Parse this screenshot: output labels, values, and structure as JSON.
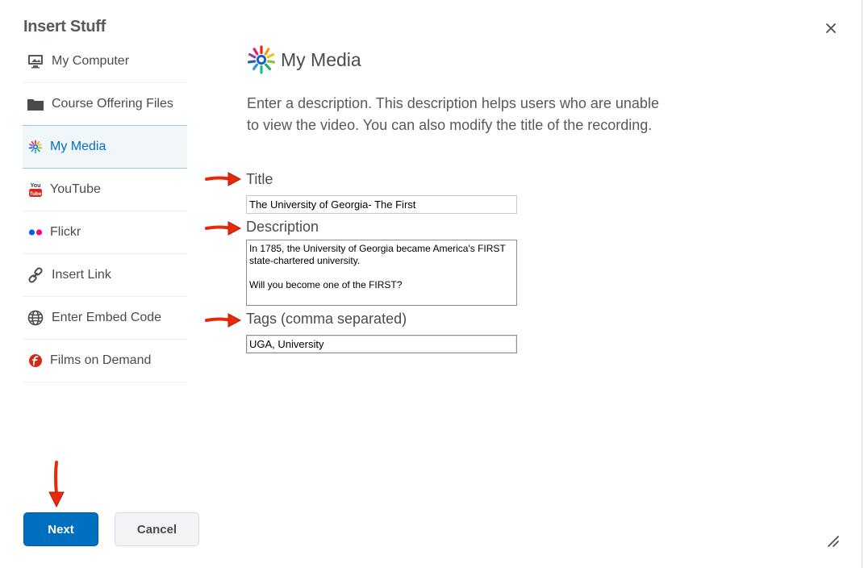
{
  "dialog": {
    "title": "Insert Stuff"
  },
  "sidebar": {
    "items": [
      {
        "label": "My Computer",
        "icon": "monitor-icon"
      },
      {
        "label": "Course Offering Files",
        "icon": "folder-icon"
      },
      {
        "label": "My Media",
        "icon": "my-media-logo-icon",
        "selected": true
      },
      {
        "label": "YouTube",
        "icon": "youtube-icon"
      },
      {
        "label": "Flickr",
        "icon": "flickr-icon"
      },
      {
        "label": "Insert Link",
        "icon": "link-icon"
      },
      {
        "label": "Enter Embed Code",
        "icon": "globe-icon"
      },
      {
        "label": "Films on Demand",
        "icon": "films-on-demand-icon"
      }
    ]
  },
  "main": {
    "title": "My Media",
    "intro": "Enter a description. This description helps users who are unable to view the video. You can also modify the title of the recording.",
    "fields": {
      "title_label": "Title",
      "title_value": "The University of Georgia- The First",
      "description_label": "Description",
      "description_value": "In 1785, the University of Georgia became America's FIRST state-chartered university.\n\nWill you become one of the FIRST?",
      "tags_label": "Tags (comma separated)",
      "tags_value": "UGA, University"
    }
  },
  "buttons": {
    "next": "Next",
    "cancel": "Cancel"
  },
  "colors": {
    "primary": "#006fbf",
    "annotation_arrow": "#e8290b",
    "selected_bg": "#f1f6fb"
  }
}
